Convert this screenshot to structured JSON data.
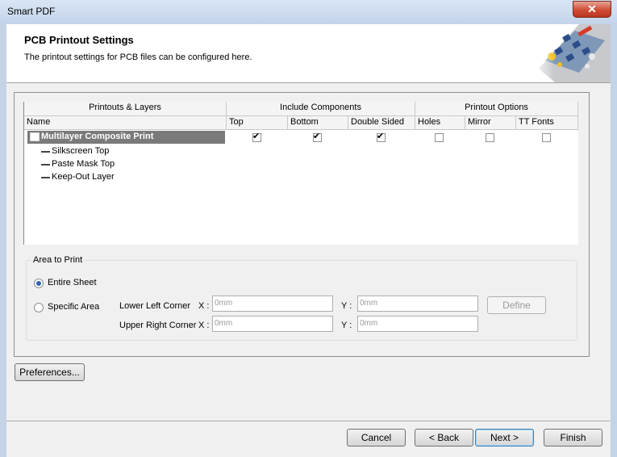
{
  "window": {
    "title": "Smart PDF",
    "close_glyph": "✕"
  },
  "header": {
    "title": "PCB Printout Settings",
    "subtitle": "The printout settings for PCB files can be configured here.",
    "graphic_icon": "pcb-board-graphic"
  },
  "table": {
    "groups": [
      "Printouts & Layers",
      "Include Components",
      "Printout Options"
    ],
    "columns": [
      "Name",
      "Top",
      "Bottom",
      "Double Sided",
      "Holes",
      "Mirror",
      "TT Fonts"
    ],
    "rows": [
      {
        "name": "Multilayer Composite Print",
        "checks": [
          true,
          true,
          true,
          false,
          false,
          false
        ]
      }
    ],
    "layers": [
      "Silkscreen Top",
      "Paste Mask Top",
      "Keep-Out Layer"
    ],
    "check_glyph": "✔"
  },
  "area": {
    "legend": "Area to Print",
    "entire_sheet": "Entire Sheet",
    "specific_area": "Specific Area",
    "selected": "entire_sheet",
    "lower_left": "Lower Left Corner",
    "upper_right": "Upper Right Corner",
    "x_label": "X :",
    "y_label": "Y :",
    "ll_x": "0mm",
    "ll_y": "0mm",
    "ur_x": "0mm",
    "ur_y": "0mm",
    "define": "Define"
  },
  "buttons": {
    "preferences": "Preferences...",
    "cancel": "Cancel",
    "back": "< Back",
    "next": "Next >",
    "finish": "Finish"
  },
  "colors": {
    "selection_gray": "#7a7a7a",
    "radio_accent": "#2b65b8"
  }
}
